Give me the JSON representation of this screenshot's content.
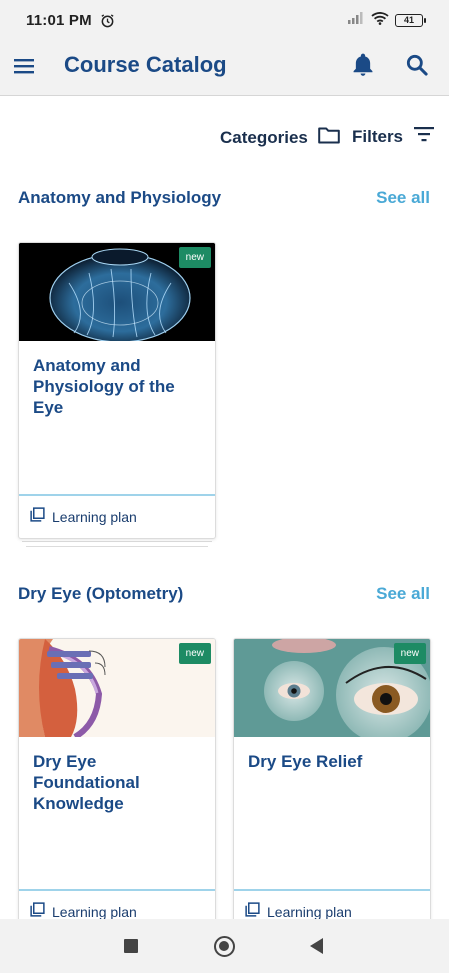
{
  "status_bar": {
    "time": "11:01 PM",
    "battery": "41",
    "icons": [
      "alarm-icon",
      "signal-icon",
      "wifi-icon",
      "battery-icon"
    ]
  },
  "app_bar": {
    "title": "Course Catalog",
    "icons": [
      "menu-icon",
      "bell-icon",
      "search-icon"
    ]
  },
  "toolbar": {
    "categories_label": "Categories",
    "filters_label": "Filters"
  },
  "sections": [
    {
      "title": "Anatomy and Physiology",
      "see_all": "See all",
      "cards": [
        {
          "title": "Anatomy and Physiology of the Eye",
          "badge": "new",
          "type": "Learning plan"
        }
      ]
    },
    {
      "title": "Dry Eye (Optometry)",
      "see_all": "See all",
      "cards": [
        {
          "title": "Dry Eye Foundational Knowledge",
          "badge": "new",
          "type": "Learning plan"
        },
        {
          "title": "Dry Eye Relief",
          "badge": "new",
          "type": "Learning plan"
        }
      ]
    }
  ],
  "colors": {
    "primary": "#1b4a86",
    "accent": "#4aa9d6",
    "badge": "#1d8b64",
    "bar_bg": "#f2f2f2"
  }
}
